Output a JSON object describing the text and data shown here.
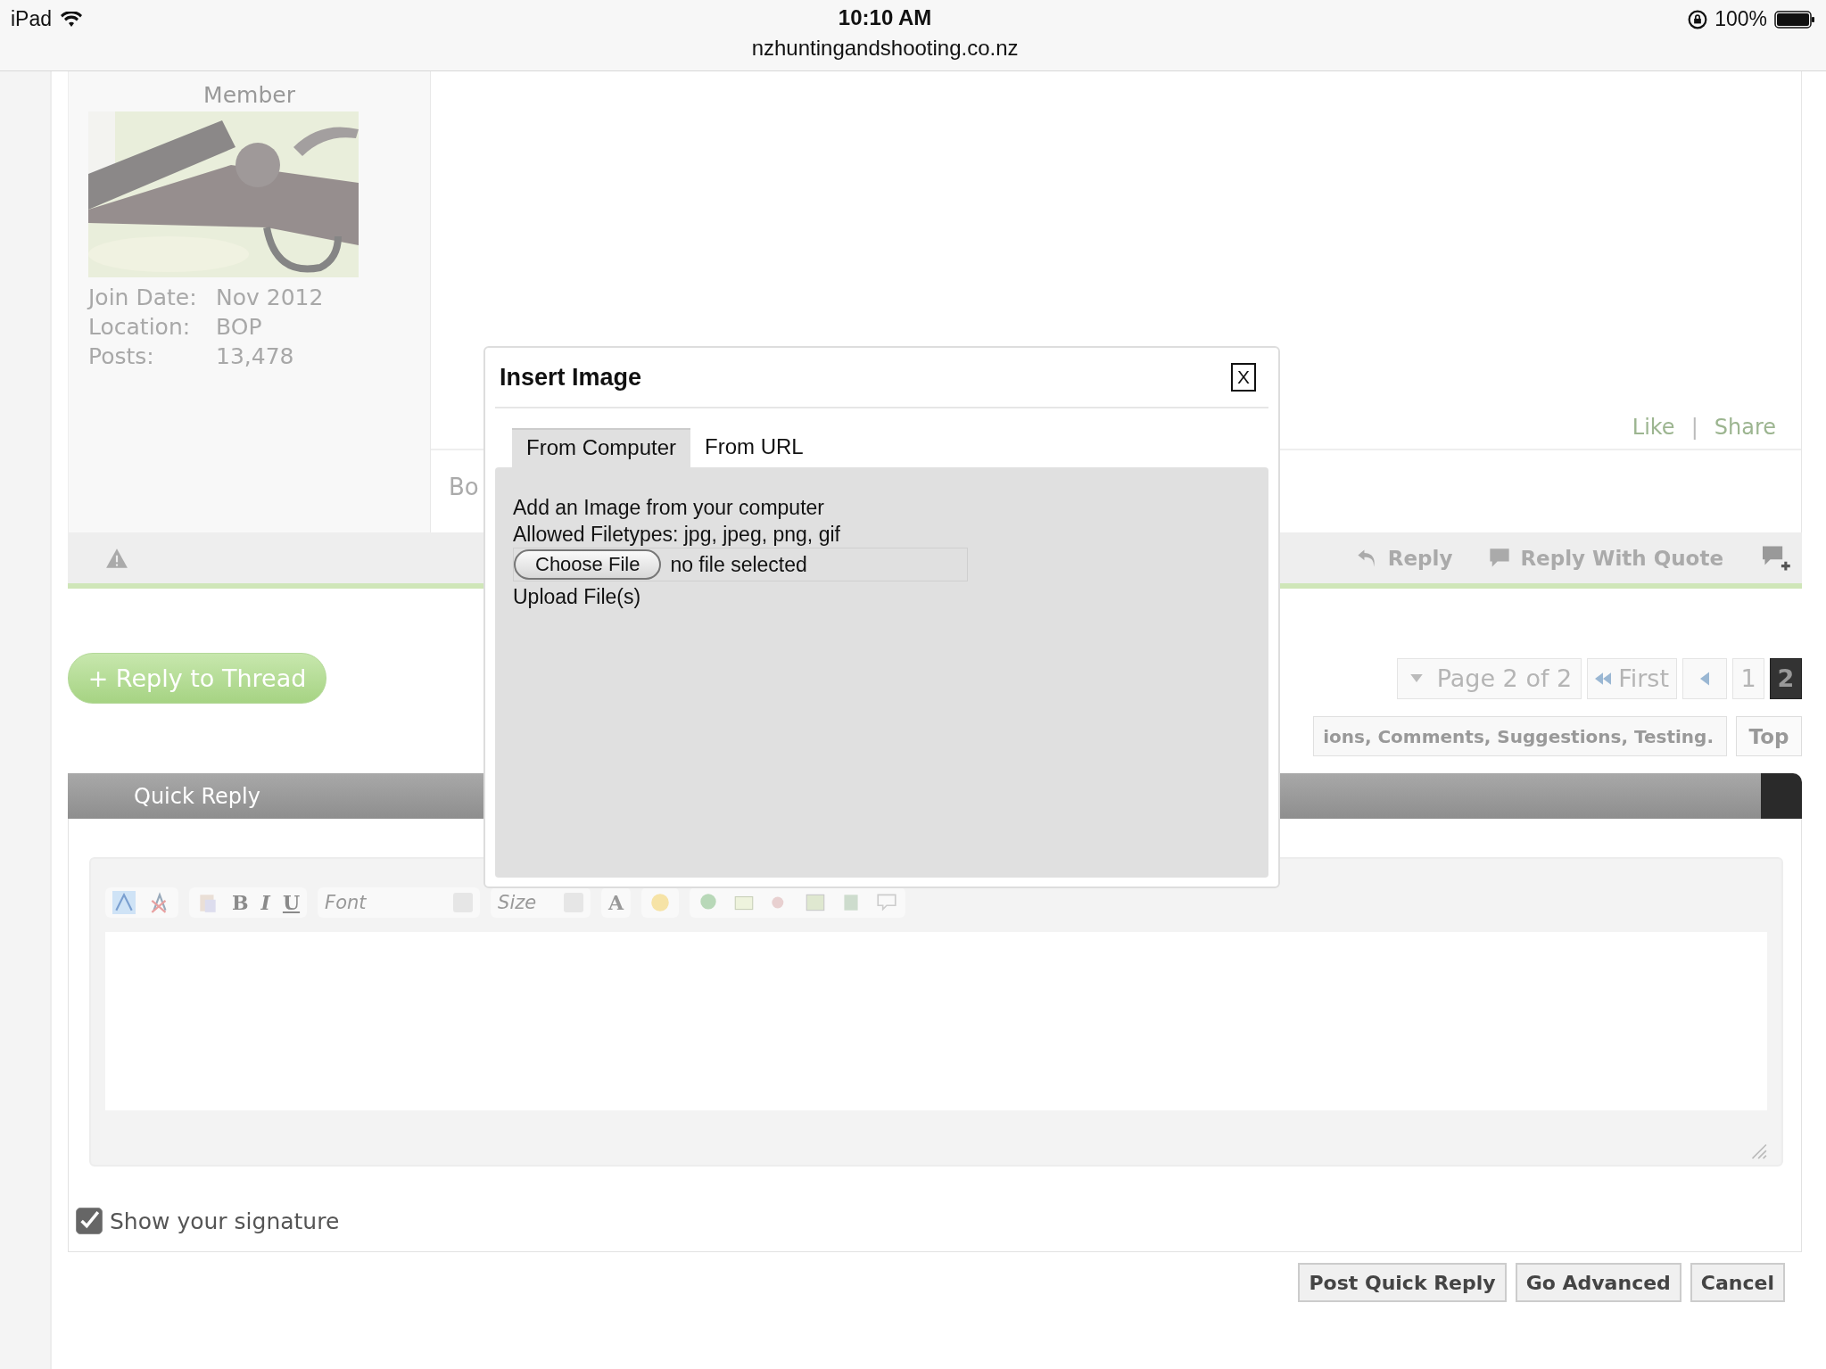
{
  "status_bar": {
    "device": "iPad",
    "time": "10:10 AM",
    "url": "nzhuntingandshooting.co.nz",
    "battery": "100%"
  },
  "post": {
    "user": {
      "title": "Member",
      "details": [
        {
          "label": "Join Date:",
          "value": "Nov 2012"
        },
        {
          "label": "Location:",
          "value": "BOP"
        },
        {
          "label": "Posts:",
          "value": "13,478"
        }
      ]
    },
    "actions": [
      "Like",
      "Share"
    ],
    "separator": "|",
    "body_fragment": "Bo",
    "toolbar": [
      "Reply",
      "Reply With Quote"
    ]
  },
  "reply_to_thread": "+ Reply to Thread",
  "pagination": {
    "summary": "Page 2 of 2",
    "first": "First",
    "pages": [
      {
        "label": "1",
        "selected": false
      },
      {
        "label": "2",
        "selected": true
      }
    ]
  },
  "breadcrumb": "ions, Comments, Suggestions, Testing.",
  "top": "Top",
  "quick_reply": {
    "title": "Quick Reply",
    "font": "Font",
    "size": "Size",
    "format": [
      "B",
      "I",
      "U"
    ],
    "color_button": "A",
    "signature": {
      "label": "Show your signature",
      "checked": true
    },
    "buttons": [
      "Post Quick Reply",
      "Go Advanced",
      "Cancel"
    ]
  },
  "dialog": {
    "title": "Insert Image",
    "close": "X",
    "tabs": [
      {
        "label": "From Computer",
        "selected": true
      },
      {
        "label": "From URL",
        "selected": false
      }
    ],
    "heading": "Add an Image from your computer",
    "filetypes": "Allowed Filetypes: jpg, jpeg, png, gif",
    "choose_button": "Choose File",
    "file_status": "no file selected",
    "upload": "Upload File(s)"
  }
}
